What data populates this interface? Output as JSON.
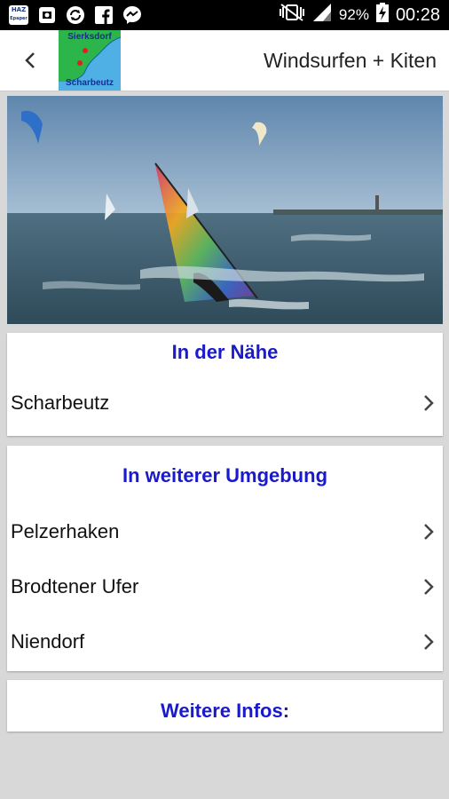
{
  "status_bar": {
    "left_icons": [
      "haz-app-icon",
      "screenshot-icon",
      "sync-icon",
      "facebook-icon",
      "messenger-icon"
    ],
    "haz_label_top": "HAZ",
    "haz_label_bottom": "Epaper",
    "battery_percent": "92%",
    "time": "00:28"
  },
  "app_bar": {
    "title": "Windsurfen + Kiten",
    "logo_top_text": "Sierksdorf",
    "logo_bottom_text": "Scharbeutz"
  },
  "sections": [
    {
      "heading": "In der Nähe",
      "items": [
        "Scharbeutz"
      ]
    },
    {
      "heading": "In weiterer Umgebung",
      "items": [
        "Pelzerhaken",
        "Brodtener Ufer",
        "Niendorf"
      ]
    },
    {
      "heading": "Weitere Infos:",
      "items": []
    }
  ],
  "colors": {
    "heading": "#1a1acc",
    "status_bar": "#000000",
    "background": "#d8d8d8",
    "logo": "#2bb54a"
  }
}
